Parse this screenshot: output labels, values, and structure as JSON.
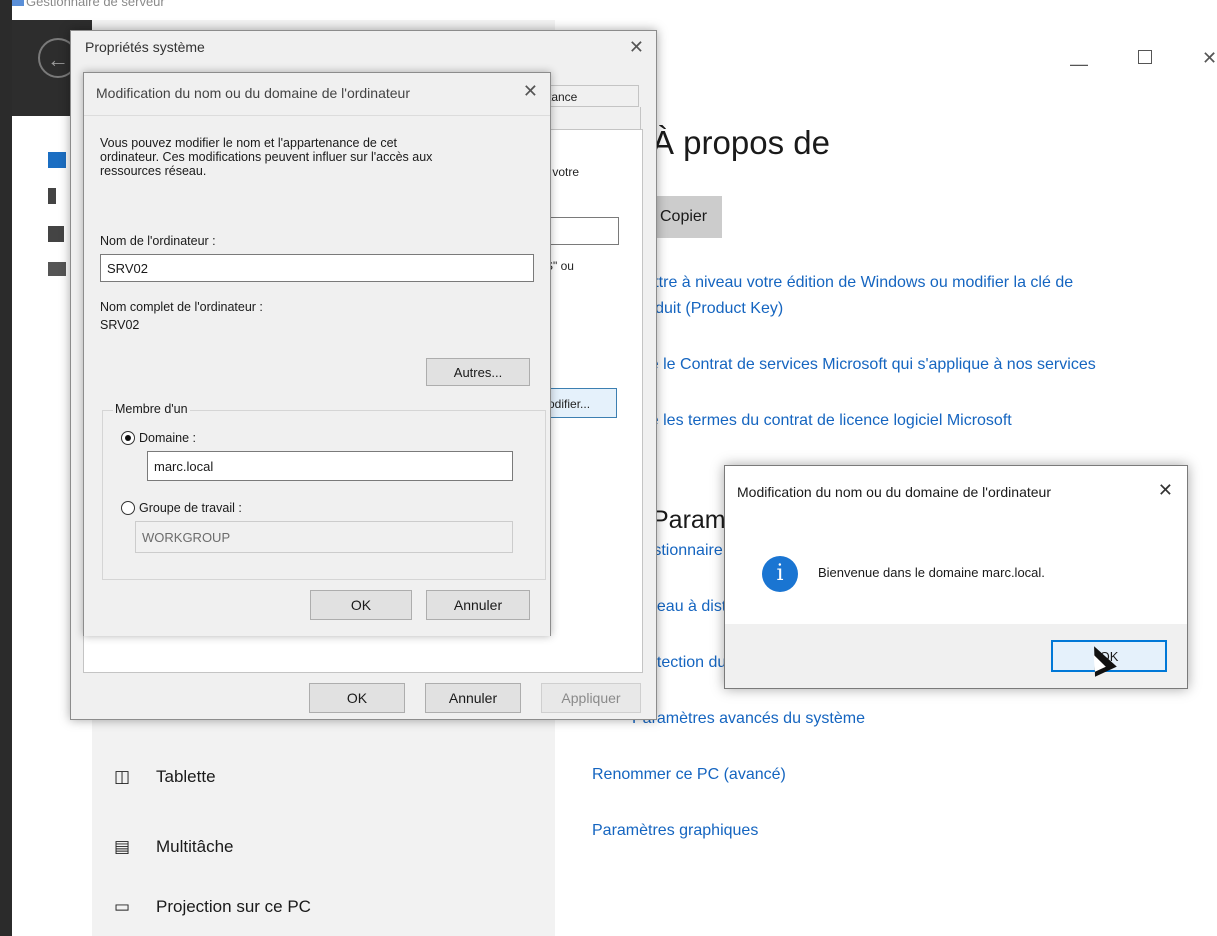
{
  "server_manager": {
    "title": "Gestionnaire de serveur"
  },
  "settings": {
    "heading": "À propos de",
    "copy_button": "Copier",
    "links": [
      "Mettre à niveau votre édition de Windows ou modifier la clé de",
      "produit (Product Key)",
      "Lire le Contrat de services Microsoft qui s'applique à nos services",
      "Lire les termes du contrat de licence logiciel Microsoft",
      "Gestionnaire de périphériques",
      "Bureau à distance",
      "Protection du système",
      "Paramètres avancés du système",
      "Renommer ce PC (avancé)",
      "Paramètres graphiques"
    ],
    "section_heading": "Paramètres associés",
    "sidebar_items": [
      {
        "label": "Tablette",
        "icon": "tablet-icon"
      },
      {
        "label": "Multitâche",
        "icon": "multitask-icon"
      },
      {
        "label": "Projection sur ce PC",
        "icon": "projection-icon"
      }
    ]
  },
  "system_properties": {
    "title": "Propriétés système",
    "tab_fragment": "tance",
    "text_frag_1": "r votre",
    "text_frag_2": "S\" ou",
    "modify_button": "odifier...",
    "ok": "OK",
    "cancel": "Annuler",
    "apply": "Appliquer"
  },
  "rename_dialog": {
    "title": "Modification du nom ou du domaine de l'ordinateur",
    "intro_line1": "Vous pouvez modifier le nom et l'appartenance de cet",
    "intro_line2": "ordinateur. Ces modifications peuvent influer sur l'accès aux",
    "intro_line3": "ressources réseau.",
    "computer_name_label": "Nom de l'ordinateur :",
    "computer_name_value": "SRV02",
    "full_name_label": "Nom complet de l'ordinateur :",
    "full_name_value": "SRV02",
    "more_button": "Autres...",
    "member_of": "Membre d'un",
    "domain_label": "Domaine :",
    "domain_value": "marc.local",
    "workgroup_label": "Groupe de travail :",
    "workgroup_value": "WORKGROUP",
    "ok": "OK",
    "cancel": "Annuler"
  },
  "welcome_box": {
    "title": "Modification du nom ou du domaine de l'ordinateur",
    "message": "Bienvenue dans le domaine marc.local.",
    "ok": "OK"
  }
}
